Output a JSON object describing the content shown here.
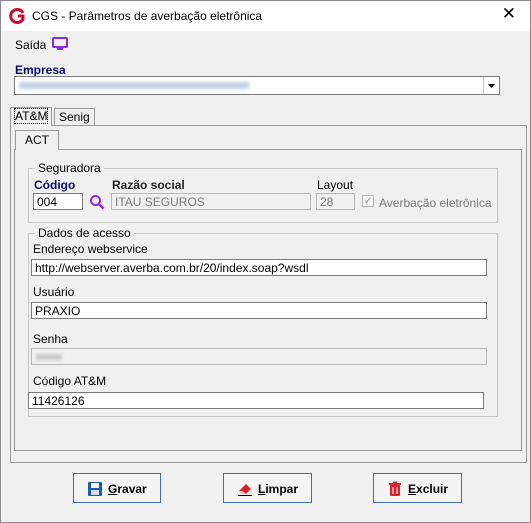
{
  "window": {
    "title": "CGS - Parâmetros de averbação eletrônica",
    "close_glyph": "✕"
  },
  "menu": {
    "saida_label": "Saída"
  },
  "empresa": {
    "label": "Empresa"
  },
  "tabs": [
    {
      "label": "AT&M"
    },
    {
      "label": "Senig"
    }
  ],
  "inner_tab": {
    "label": "ACT"
  },
  "seguradora": {
    "group_label": "Seguradora",
    "codigo_label": "Código",
    "codigo_value": "004",
    "razao_label": "Razão social",
    "razao_value": "ITAU SEGUROS",
    "layout_label": "Layout",
    "layout_value": "28",
    "averbacao_label": "Averbação eletrônica",
    "averbacao_checked": true
  },
  "acesso": {
    "group_label": "Dados de acesso",
    "endereco_label": "Endereço webservice",
    "endereco_value": "http://webserver.averba.com.br/20/index.soap?wsdl",
    "usuario_label": "Usuário",
    "usuario_value": "PRAXIO",
    "senha_label": "Senha",
    "codigo_atm_label": "Código AT&M",
    "codigo_atm_value": "11426126"
  },
  "buttons": {
    "gravar_first": "G",
    "gravar_rest": "ravar",
    "limpar_first": "L",
    "limpar_rest": "impar",
    "excluir_first": "E",
    "excluir_rest": "xcluir"
  },
  "colors": {
    "accent": "#0a0a6e",
    "app_logo": "#c8102e",
    "monitor_icon": "#8a2be2",
    "delete_red": "#d4242c",
    "save_blue": "#1f5aa8"
  }
}
